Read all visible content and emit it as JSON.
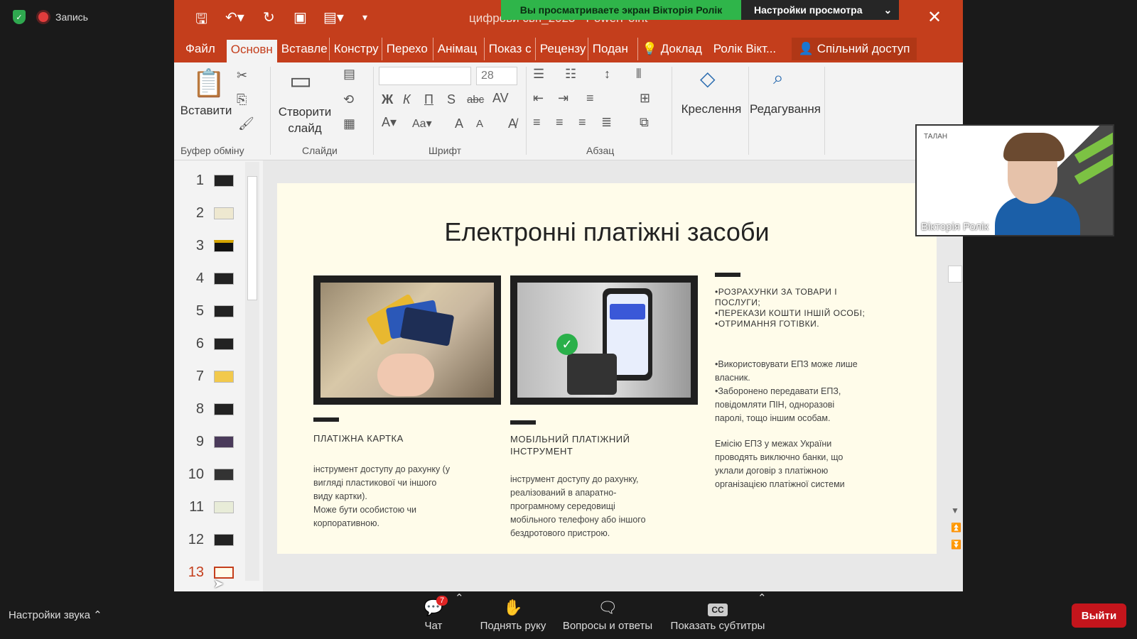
{
  "conference": {
    "recording_label": "Запись",
    "sharing_banner": "Вы просматриваете экран Вікторія Ролік",
    "view_settings": "Настройки просмотра",
    "sound_settings": "Настройки звука",
    "chat_label": "Чат",
    "chat_badge": "7",
    "raise_hand": "Поднять руку",
    "qa": "Вопросы и ответы",
    "subtitles": "Показать субтитры",
    "cc": "CC",
    "exit": "Выйти",
    "camera_name": "Вікторія Ролік",
    "camera_logo": "ТАЛАН"
  },
  "ppt": {
    "doc_title": "цифрови свп_2023 - PowerPoint",
    "tabs": [
      "Файл",
      "Основн",
      "Вставле",
      "Констру",
      "Перехо",
      "Анімац",
      "Показ с",
      "Рецензу",
      "Подан",
      "Доклад",
      "Ролік Вікт...",
      "Спільний доступ"
    ],
    "ribbon": {
      "paste": "Вставити",
      "new_slide": "Створити слайд",
      "drawing": "Креслення",
      "editing": "Редагування",
      "font_size": "28",
      "group_clipboard": "Буфер обміну",
      "group_slides": "Слайди",
      "group_font": "Шрифт",
      "group_paragraph": "Абзац",
      "bold": "Ж",
      "italic": "К",
      "underline": "П",
      "strike": "S",
      "abc": "abc"
    },
    "slide_numbers": [
      "1",
      "2",
      "3",
      "4",
      "5",
      "6",
      "7",
      "8",
      "9",
      "10",
      "11",
      "12",
      "13"
    ]
  },
  "slide": {
    "title": "Електронні платіжні засоби",
    "card_caption": "ПЛАТІЖНА КАРТКА",
    "card_body": [
      "інструмент доступу до рахунку (у",
      "вигляді пластикової чи іншого",
      "виду картки).",
      "Може бути особистою чи",
      "корпоративною."
    ],
    "mobile_caption": [
      "МОБІЛЬНИЙ ПЛАТІЖНИЙ",
      "ІНСТРУМЕНТ"
    ],
    "mobile_body": [
      "інструмент доступу до рахунку,",
      "реалізований в апаратно-",
      "програмному середовищі",
      "мобільного телефону або іншого",
      "бездротового пристрою."
    ],
    "uses": [
      "•РОЗРАХУНКИ ЗА ТОВАРИ І",
      "ПОСЛУГИ;",
      "•ПЕРЕКАЗИ КОШТИ ІНШІЙ ОСОБІ;",
      "•ОТРИМАННЯ ГОТІВКИ."
    ],
    "rules": [
      "•Використовувати ЕПЗ може лише",
      "власник.",
      "•Заборонено передавати ЕПЗ,",
      "повідомляти ПІН, одноразові",
      "паролі, тощо іншим особам."
    ],
    "emission": [
      "Емісію ЕПЗ у межах України",
      "проводять виключно банки, що",
      "уклали договір з платіжною",
      "організацією платіжної системи"
    ]
  }
}
